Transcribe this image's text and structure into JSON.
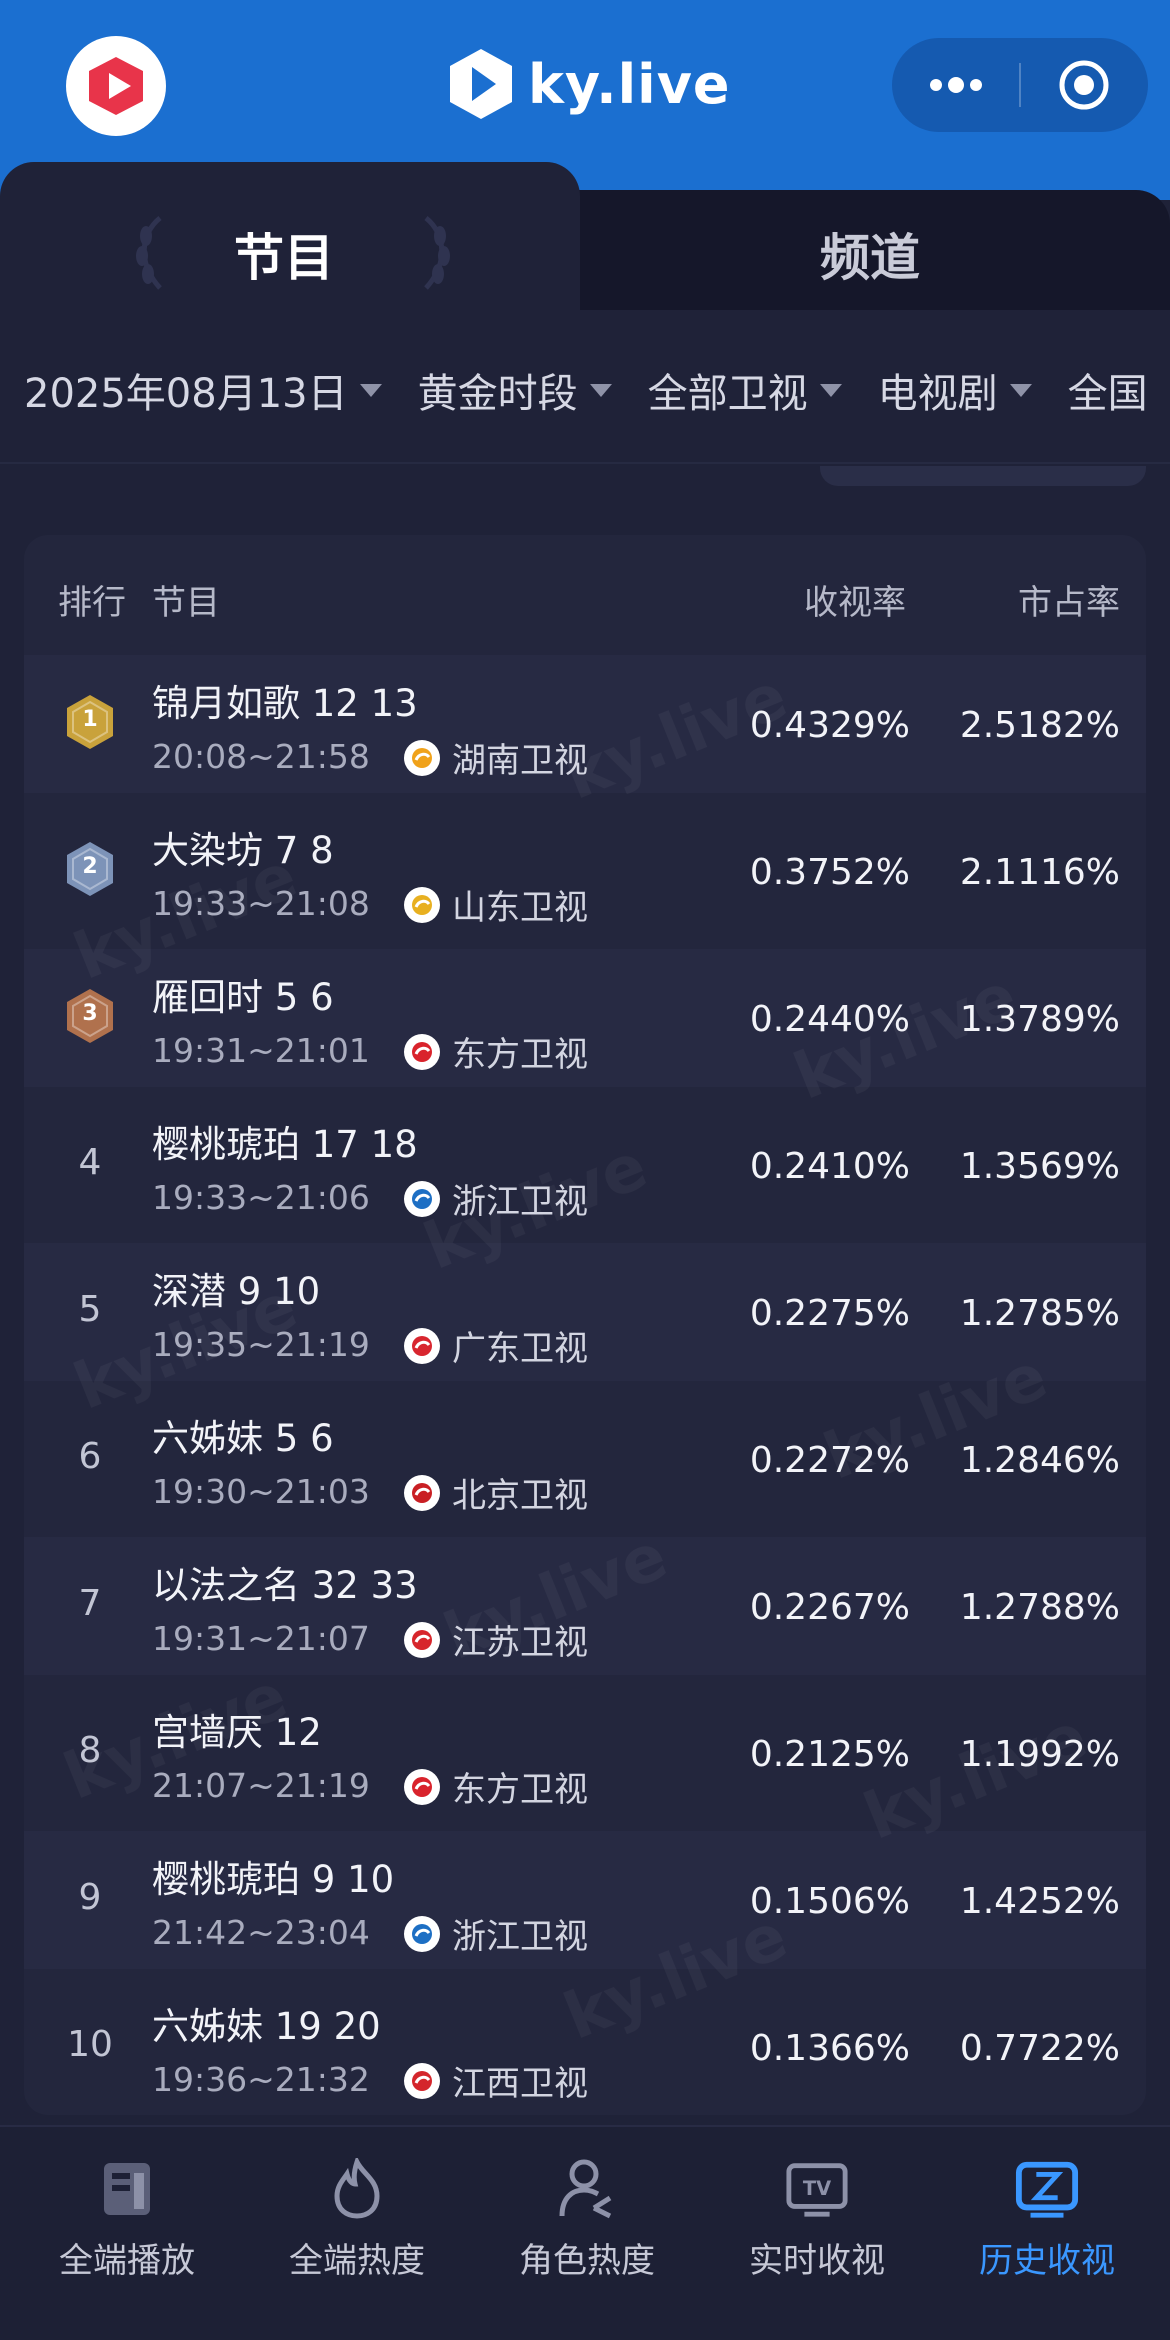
{
  "header": {
    "brand": "ky.live",
    "capsule_more": "more-dots",
    "capsule_close": "target"
  },
  "tabs": [
    {
      "label": "节目",
      "active": true
    },
    {
      "label": "频道",
      "active": false
    }
  ],
  "filters": [
    {
      "label": "2025年08月13日"
    },
    {
      "label": "黄金时段"
    },
    {
      "label": "全部卫视"
    },
    {
      "label": "电视剧"
    },
    {
      "label": "全国"
    }
  ],
  "table": {
    "headers": {
      "rank": "排行",
      "program": "节目",
      "rating": "收视率",
      "share": "市占率"
    },
    "rows": [
      {
        "rank": "1",
        "title": "锦月如歌 12 13",
        "time": "20:08~21:58",
        "channel": "湖南卫视",
        "rating": "0.4329%",
        "share": "2.5182%",
        "medal": "gold",
        "ch_color": "#f0a21b"
      },
      {
        "rank": "2",
        "title": "大染坊 7 8",
        "time": "19:33~21:08",
        "channel": "山东卫视",
        "rating": "0.3752%",
        "share": "2.1116%",
        "medal": "silver",
        "ch_color": "#e8b020"
      },
      {
        "rank": "3",
        "title": "雁回时 5 6",
        "time": "19:31~21:01",
        "channel": "东方卫视",
        "rating": "0.2440%",
        "share": "1.3789%",
        "medal": "bronze",
        "ch_color": "#d9232c"
      },
      {
        "rank": "4",
        "title": "樱桃琥珀 17 18",
        "time": "19:33~21:06",
        "channel": "浙江卫视",
        "rating": "0.2410%",
        "share": "1.3569%",
        "medal": "",
        "ch_color": "#1d6fc4"
      },
      {
        "rank": "5",
        "title": "深潜 9 10",
        "time": "19:35~21:19",
        "channel": "广东卫视",
        "rating": "0.2275%",
        "share": "1.2785%",
        "medal": "",
        "ch_color": "#d8262f"
      },
      {
        "rank": "6",
        "title": "六姊妹 5 6",
        "time": "19:30~21:03",
        "channel": "北京卫视",
        "rating": "0.2272%",
        "share": "1.2846%",
        "medal": "",
        "ch_color": "#c91f24"
      },
      {
        "rank": "7",
        "title": "以法之名 32 33",
        "time": "19:31~21:07",
        "channel": "江苏卫视",
        "rating": "0.2267%",
        "share": "1.2788%",
        "medal": "",
        "ch_color": "#d7262c"
      },
      {
        "rank": "8",
        "title": "宫墙厌 12",
        "time": "21:07~21:19",
        "channel": "东方卫视",
        "rating": "0.2125%",
        "share": "1.1992%",
        "medal": "",
        "ch_color": "#d9232c"
      },
      {
        "rank": "9",
        "title": "樱桃琥珀 9 10",
        "time": "21:42~23:04",
        "channel": "浙江卫视",
        "rating": "0.1506%",
        "share": "1.4252%",
        "medal": "",
        "ch_color": "#1d6fc4"
      },
      {
        "rank": "10",
        "title": "六姊妹 19 20",
        "time": "19:36~21:32",
        "channel": "江西卫视",
        "rating": "0.1366%",
        "share": "0.7722%",
        "medal": "",
        "ch_color": "#d4262c"
      }
    ]
  },
  "watermark": "ky.live",
  "bottom_nav": [
    {
      "label": "全端播放",
      "icon": "book-icon",
      "active": false
    },
    {
      "label": "全端热度",
      "icon": "flame-icon",
      "active": false
    },
    {
      "label": "角色热度",
      "icon": "person-icon",
      "active": false
    },
    {
      "label": "实时收视",
      "icon": "tv-icon",
      "active": false
    },
    {
      "label": "历史收视",
      "icon": "history-icon",
      "active": true
    }
  ],
  "colors": {
    "header_blue": "#1b6fd0",
    "background": "#1f2238",
    "active_nav": "#3a97ff",
    "gold": "#c9a23b",
    "silver": "#7d93b8",
    "bronze": "#b0714d"
  }
}
